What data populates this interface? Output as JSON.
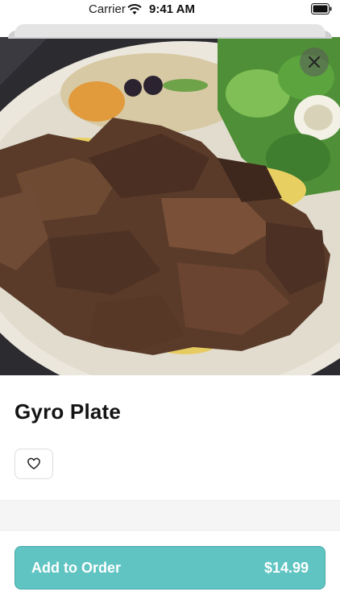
{
  "status_bar": {
    "carrier": "Carrier",
    "time": "9:41 AM",
    "icons": [
      "wifi-icon",
      "battery-icon"
    ]
  },
  "hero": {
    "image_subject": "gyro plate photo",
    "close_icon": "close-icon"
  },
  "item": {
    "title": "Gyro Plate",
    "favorite_icon": "heart-icon"
  },
  "cta": {
    "label": "Add to Order",
    "price": "$14.99",
    "color": "#5fc4c2"
  }
}
